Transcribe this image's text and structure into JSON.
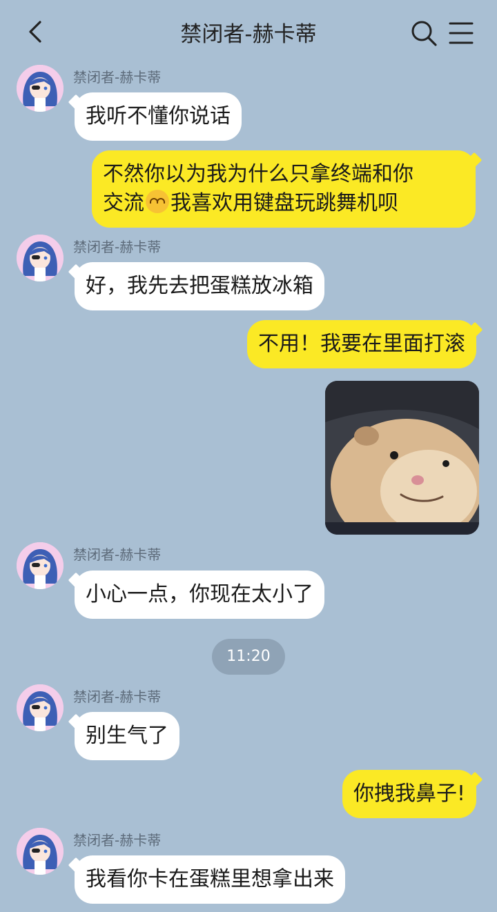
{
  "header": {
    "title": "禁闭者-赫卡蒂",
    "back_icon": "chevron-left-icon",
    "search_icon": "search-icon",
    "menu_icon": "menu-icon"
  },
  "messages": [
    {
      "sender": "禁闭者-赫卡蒂",
      "text": "我听不懂你说话"
    },
    {
      "line1": "不然你以为我为什么只拿终端和你",
      "line2_a": "交流",
      "line2_b": "我喜欢用键盘玩跳舞机呗",
      "emoji": "upside-down-face-emoji"
    },
    {
      "sender": "禁闭者-赫卡蒂",
      "text": "好，我先去把蛋糕放冰箱"
    },
    {
      "text": "不用！我要在里面打滚"
    },
    {
      "image": "hamster-smiling-photo"
    },
    {
      "sender": "禁闭者-赫卡蒂",
      "text": "小心一点，你现在太小了"
    },
    {
      "time": "11:20"
    },
    {
      "sender": "禁闭者-赫卡蒂",
      "text": "别生气了"
    },
    {
      "text": "你拽我鼻子!"
    },
    {
      "sender": "禁闭者-赫卡蒂",
      "text": "我看你卡在蛋糕里想拿出来"
    }
  ],
  "colors": {
    "background": "#a9bfd3",
    "incoming_bubble": "#ffffff",
    "outgoing_bubble": "#fbe925",
    "time_pill": "#8fa3b6"
  }
}
